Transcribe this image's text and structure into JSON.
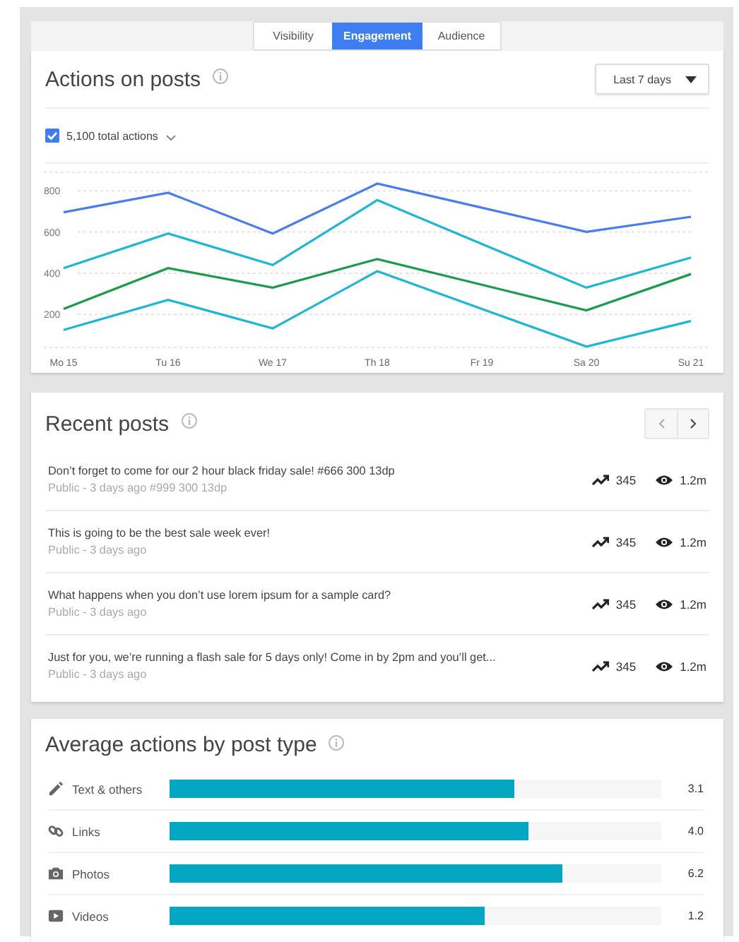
{
  "tabs": [
    {
      "label": "Visibility",
      "selected": false
    },
    {
      "label": "Engagement",
      "selected": true
    },
    {
      "label": "Audience",
      "selected": false
    }
  ],
  "actions_card": {
    "title": "Actions on posts",
    "range_dropdown": "Last 7 days",
    "total_toggle": {
      "label": "5,100 total actions",
      "checked": true
    },
    "chart_data": {
      "type": "line",
      "categories": [
        "Mo 15",
        "Tu 16",
        "We 17",
        "Th 18",
        "Fr 19",
        "Sa 20",
        "Su 21"
      ],
      "ylim": [
        40,
        890
      ],
      "yticks": [
        200,
        400,
        600,
        800
      ],
      "grid": true,
      "series": [
        {
          "color": "#4a7cf0",
          "values": [
            696,
            791,
            593,
            835,
            718,
            601,
            674
          ]
        },
        {
          "color": "#1ab8d4",
          "values": [
            425,
            593,
            440,
            755,
            542,
            330,
            476
          ]
        },
        {
          "color": "#1a9d4a",
          "values": [
            227,
            425,
            330,
            469,
            344,
            220,
            396
          ]
        },
        {
          "color": "#1ab8d4",
          "values": [
            125,
            271,
            132,
            410,
            227,
            44,
            168
          ]
        }
      ]
    }
  },
  "recent_posts": {
    "title": "Recent posts",
    "posts": [
      {
        "text": "Don’t forget to come for our 2 hour black friday sale!  #666 300 13dp",
        "meta": "Public - 3 days ago #999 300 13dp",
        "actions": "345",
        "views": "1.2m"
      },
      {
        "text": "This is going to be the best sale week ever!",
        "meta": "Public - 3 days ago",
        "actions": "345",
        "views": "1.2m"
      },
      {
        "text": "What happens when you don’t use lorem ipsum for a sample card?",
        "meta": "Public - 3 days ago",
        "actions": "345",
        "views": "1.2m"
      },
      {
        "text": "Just for you, we’re running a flash sale for 5 days only! Come in by 2pm and you’ll get...",
        "meta": "Public - 3 days ago",
        "actions": "345",
        "views": "1.2m"
      }
    ]
  },
  "post_types": {
    "title": "Average actions by post type",
    "rows": [
      {
        "kind": "text",
        "label": "Text & others",
        "level": 0.7,
        "value": "3.1"
      },
      {
        "kind": "link",
        "label": "Links",
        "level": 0.73,
        "value": "4.0"
      },
      {
        "kind": "photo",
        "label": "Photos",
        "level": 0.8,
        "value": "6.2"
      },
      {
        "kind": "video",
        "label": "Videos",
        "level": 0.64,
        "value": "1.2"
      }
    ]
  }
}
